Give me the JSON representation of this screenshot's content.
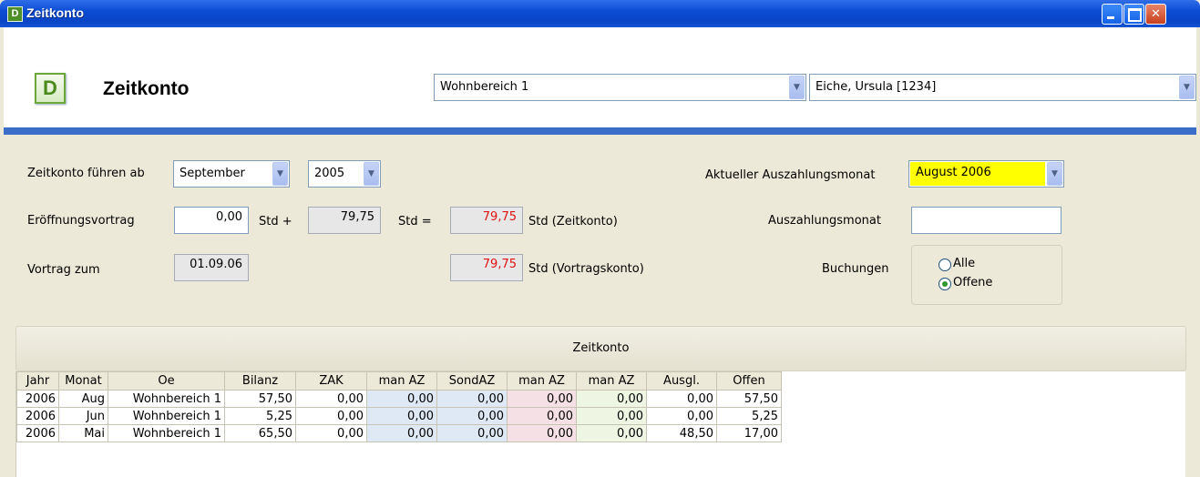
{
  "window": {
    "title": "Zeitkonto",
    "app_icon": "D"
  },
  "header": {
    "logo": "D",
    "title": "Zeitkonto",
    "area_select": "Wohnbereich 1",
    "person_select": "Eiche, Ursula [1234]"
  },
  "form": {
    "start_label": "Zeitkonto führen ab",
    "start_month": "September",
    "start_year": "2005",
    "opening_label": "Eröffnungsvortrag",
    "opening_value": "0,00",
    "std_plus": "Std +",
    "plus_value": "79,75",
    "std_equals": "Std =",
    "zeitkonto_value": "79,75",
    "zeitkonto_unit": "Std (Zeitkonto)",
    "carry_label": "Vortrag zum",
    "carry_date": "01.09.06",
    "vortrag_value": "79,75",
    "vortrag_unit": "Std (Vortragskonto)",
    "current_payout_label": "Aktueller Auszahlungsmonat",
    "current_payout_value": "August 2006",
    "payout_label": "Auszahlungsmonat",
    "payout_value": "",
    "bookings_label": "Buchungen",
    "radio_all": "Alle",
    "radio_open": "Offene",
    "selected_radio": "Offene"
  },
  "section_title": "Zeitkonto",
  "table": {
    "columns": [
      "Jahr",
      "Monat",
      "Oe",
      "Bilanz",
      "ZAK",
      "man AZ",
      "SondAZ",
      "man AZ",
      "man AZ",
      "Ausgl.",
      "Offen"
    ],
    "rows": [
      [
        "2006",
        "Aug",
        "Wohnbereich 1",
        "57,50",
        "0,00",
        "0,00",
        "0,00",
        "0,00",
        "0,00",
        "0,00",
        "57,50"
      ],
      [
        "2006",
        "Jun",
        "Wohnbereich 1",
        "5,25",
        "0,00",
        "0,00",
        "0,00",
        "0,00",
        "0,00",
        "0,00",
        "5,25"
      ],
      [
        "2006",
        "Mai",
        "Wohnbereich 1",
        "65,50",
        "0,00",
        "0,00",
        "0,00",
        "0,00",
        "0,00",
        "48,50",
        "17,00"
      ]
    ]
  },
  "colors": {
    "highlight": "#ffff00",
    "negative_text": "#e01010",
    "accent_blue": "#3a6ec8"
  }
}
